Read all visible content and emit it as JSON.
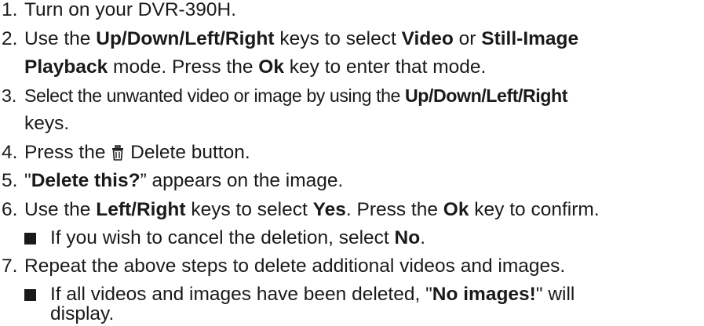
{
  "steps": [
    {
      "num": "1.",
      "runs": [
        {
          "t": "Turn on your DVR-390H."
        }
      ]
    },
    {
      "num": "2.",
      "runs": [
        {
          "t": "Use the "
        },
        {
          "t": "Up/Down/Left/Right",
          "b": true
        },
        {
          "t": " keys to select "
        },
        {
          "t": "Video",
          "b": true
        },
        {
          "t": " or "
        },
        {
          "t": "Still-Image",
          "b": true
        }
      ],
      "cont": [
        {
          "t": "Playback",
          "b": true
        },
        {
          "t": " mode. Press the "
        },
        {
          "t": "Ok",
          "b": true
        },
        {
          "t": " key to enter that mode."
        }
      ]
    },
    {
      "num": "3.",
      "runs": [
        {
          "t": "Select the unwanted video or image by using the "
        },
        {
          "t": "Up/Down/Left/Right",
          "b": true
        }
      ],
      "cont": [
        {
          "t": "keys."
        }
      ]
    },
    {
      "num": "4.",
      "runs": [
        {
          "t": "Press the "
        },
        {
          "icon": "trash-icon"
        },
        {
          "t": " Delete button."
        }
      ]
    },
    {
      "num": "5.",
      "runs": [
        {
          "t": "\""
        },
        {
          "t": "Delete this?",
          "b": true
        },
        {
          "t": "” appears on the image."
        }
      ]
    },
    {
      "num": "6.",
      "runs": [
        {
          "t": "Use the "
        },
        {
          "t": "Left/Right",
          "b": true
        },
        {
          "t": " keys to select "
        },
        {
          "t": "Yes",
          "b": true
        },
        {
          "t": ". Press the "
        },
        {
          "t": "Ok",
          "b": true
        },
        {
          "t": " key to confirm."
        }
      ],
      "bullets": [
        {
          "runs": [
            {
              "t": "If you wish to cancel the deletion, select "
            },
            {
              "t": "No",
              "b": true
            },
            {
              "t": "."
            }
          ]
        }
      ]
    },
    {
      "num": "7.",
      "runs": [
        {
          "t": "Repeat the above steps to delete additional videos and images."
        }
      ],
      "bullets": [
        {
          "runs": [
            {
              "t": "If all videos and images have been deleted, \""
            },
            {
              "t": "No images!",
              "b": true
            },
            {
              "t": "\" will"
            }
          ],
          "cont": [
            {
              "t": "display."
            }
          ]
        }
      ]
    }
  ]
}
